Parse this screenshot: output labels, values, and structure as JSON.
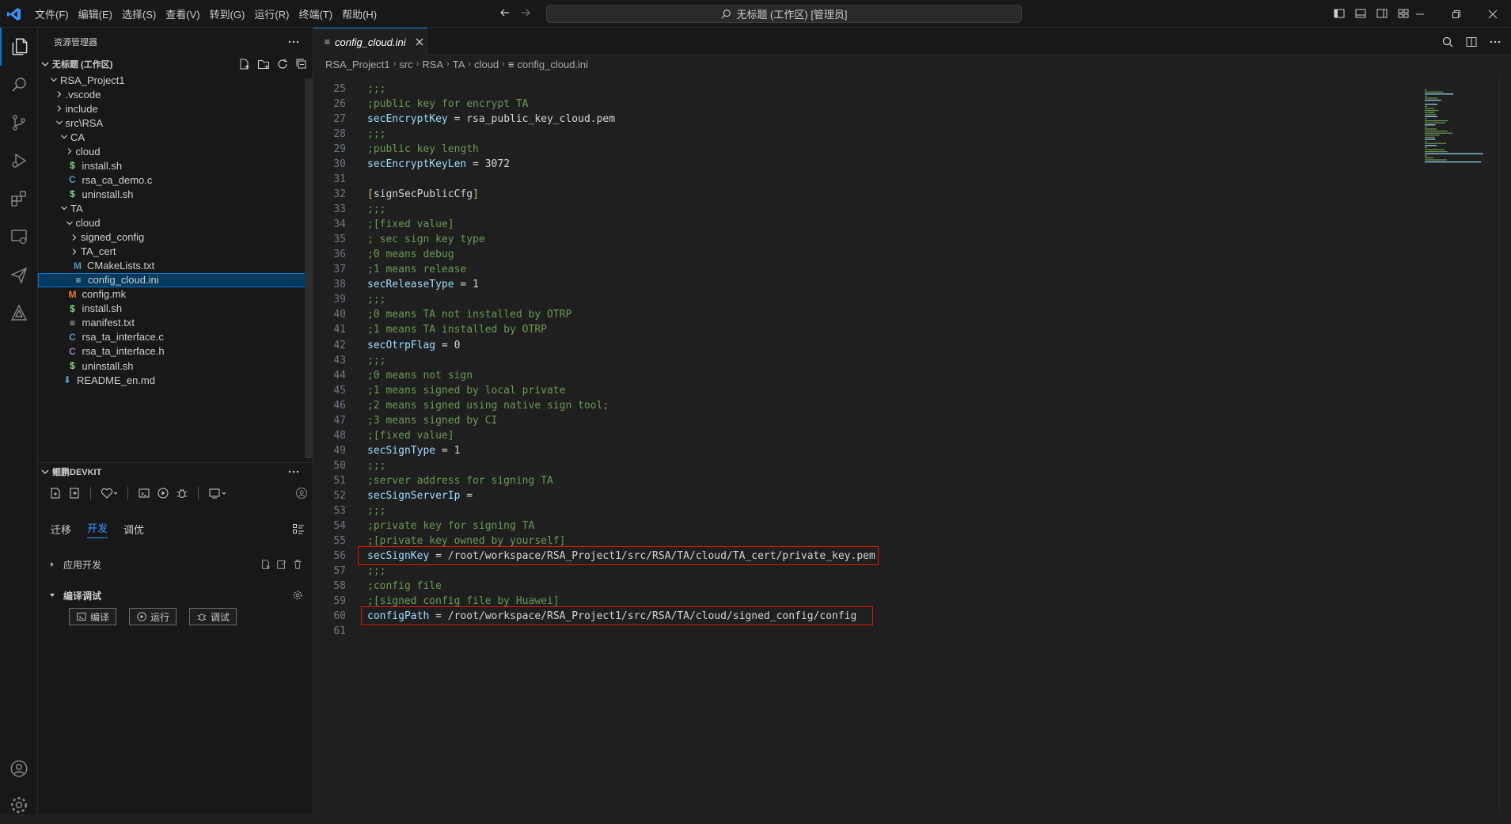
{
  "titlebar": {
    "menu": [
      "文件(F)",
      "编辑(E)",
      "选择(S)",
      "查看(V)",
      "转到(G)",
      "运行(R)",
      "终端(T)",
      "帮助(H)"
    ],
    "search_text": "无标题 (工作区) [管理员]"
  },
  "sidebar": {
    "title": "资源管理器",
    "workspace_title": "无标题 (工作区)",
    "tree": [
      {
        "label": "RSA_Project1",
        "twisty": "open",
        "icon": "",
        "color": ""
      },
      {
        "label": ".vscode",
        "twisty": "closed",
        "icon": "",
        "color": ""
      },
      {
        "label": "include",
        "twisty": "closed",
        "icon": "",
        "color": ""
      },
      {
        "label": "src\\RSA",
        "twisty": "open",
        "icon": "",
        "color": ""
      },
      {
        "label": "CA",
        "twisty": "open",
        "icon": "",
        "color": ""
      },
      {
        "label": "cloud",
        "twisty": "closed",
        "icon": "",
        "color": ""
      },
      {
        "label": "install.sh",
        "twisty": "none",
        "icon": "$",
        "color": "#89d185"
      },
      {
        "label": "rsa_ca_demo.c",
        "twisty": "none",
        "icon": "C",
        "color": "#519aba"
      },
      {
        "label": "uninstall.sh",
        "twisty": "none",
        "icon": "$",
        "color": "#89d185"
      },
      {
        "label": "TA",
        "twisty": "open",
        "icon": "",
        "color": ""
      },
      {
        "label": "cloud",
        "twisty": "open",
        "icon": "",
        "color": ""
      },
      {
        "label": "signed_config",
        "twisty": "closed",
        "icon": "",
        "color": ""
      },
      {
        "label": "TA_cert",
        "twisty": "closed",
        "icon": "",
        "color": ""
      },
      {
        "label": "CMakeLists.txt",
        "twisty": "none",
        "icon": "M",
        "color": "#519aba"
      },
      {
        "label": "config_cloud.ini",
        "twisty": "none",
        "icon": "≡",
        "color": "#cccccc"
      },
      {
        "label": "config.mk",
        "twisty": "none",
        "icon": "M",
        "color": "#e37933"
      },
      {
        "label": "install.sh",
        "twisty": "none",
        "icon": "$",
        "color": "#89d185"
      },
      {
        "label": "manifest.txt",
        "twisty": "none",
        "icon": "≡",
        "color": "#cccccc"
      },
      {
        "label": "rsa_ta_interface.c",
        "twisty": "none",
        "icon": "C",
        "color": "#519aba"
      },
      {
        "label": "rsa_ta_interface.h",
        "twisty": "none",
        "icon": "C",
        "color": "#a074c4"
      },
      {
        "label": "uninstall.sh",
        "twisty": "none",
        "icon": "$",
        "color": "#89d185"
      },
      {
        "label": "README_en.md",
        "twisty": "none",
        "icon": "⬇",
        "color": "#519aba"
      }
    ]
  },
  "devkit": {
    "title": "鲲鹏DEVKIT",
    "tabs": [
      "迁移",
      "开发",
      "调优"
    ],
    "active_tab": "开发",
    "app_dev_label": "应用开发",
    "build_debug_label": "编译调试",
    "buttons": {
      "compile": "编译",
      "run": "运行",
      "debug": "调试"
    }
  },
  "editor": {
    "tab_label": "config_cloud.ini",
    "breadcrumbs": [
      "RSA_Project1",
      "src",
      "RSA",
      "TA",
      "cloud",
      "config_cloud.ini"
    ],
    "lines": [
      {
        "n": "25",
        "t": ";;;"
      },
      {
        "n": "26",
        "t": ";public key for encrypt TA"
      },
      {
        "n": "27",
        "t": "secEncryptKey = rsa_public_key_cloud.pem"
      },
      {
        "n": "28",
        "t": ";;;"
      },
      {
        "n": "29",
        "t": ";public key length"
      },
      {
        "n": "30",
        "t": "secEncryptKeyLen = 3072"
      },
      {
        "n": "31",
        "t": ""
      },
      {
        "n": "32",
        "t": "[signSecPublicCfg]"
      },
      {
        "n": "33",
        "t": ";;;"
      },
      {
        "n": "34",
        "t": ";[fixed value]"
      },
      {
        "n": "35",
        "t": "; sec sign key type"
      },
      {
        "n": "36",
        "t": ";0 means debug"
      },
      {
        "n": "37",
        "t": ";1 means release"
      },
      {
        "n": "38",
        "t": "secReleaseType = 1"
      },
      {
        "n": "39",
        "t": ";;;"
      },
      {
        "n": "40",
        "t": ";0 means TA not installed by OTRP"
      },
      {
        "n": "41",
        "t": ";1 means TA installed by OTRP"
      },
      {
        "n": "42",
        "t": "secOtrpFlag = 0"
      },
      {
        "n": "43",
        "t": ";;;"
      },
      {
        "n": "44",
        "t": ";0 means not sign"
      },
      {
        "n": "45",
        "t": ";1 means signed by local private"
      },
      {
        "n": "46",
        "t": ";2 means signed using native sign tool;"
      },
      {
        "n": "47",
        "t": ";3 means signed by CI"
      },
      {
        "n": "48",
        "t": ";[fixed value]"
      },
      {
        "n": "49",
        "t": "secSignType = 1"
      },
      {
        "n": "50",
        "t": ";;;"
      },
      {
        "n": "51",
        "t": ";server address for signing TA"
      },
      {
        "n": "52",
        "t": "secSignServerIp ="
      },
      {
        "n": "53",
        "t": ";;;"
      },
      {
        "n": "54",
        "t": ";private key for signing TA"
      },
      {
        "n": "55",
        "t": ";[private key owned by yourself]"
      },
      {
        "n": "56",
        "t": "secSignKey = /root/workspace/RSA_Project1/src/RSA/TA/cloud/TA_cert/private_key.pem"
      },
      {
        "n": "57",
        "t": ";;;"
      },
      {
        "n": "58",
        "t": ";config file"
      },
      {
        "n": "59",
        "t": ";[signed config file by Huawei]"
      },
      {
        "n": "60",
        "t": "configPath = /root/workspace/RSA_Project1/src/RSA/TA/cloud/signed_config/config"
      },
      {
        "n": "61",
        "t": ""
      }
    ],
    "highlighted_lines": [
      "56",
      "60"
    ]
  },
  "colors": {
    "accent": "#0078d4",
    "highlight_box": "#e51400",
    "comment": "#6a9955",
    "key": "#9cdcfe",
    "section": "#d7ba7d"
  }
}
